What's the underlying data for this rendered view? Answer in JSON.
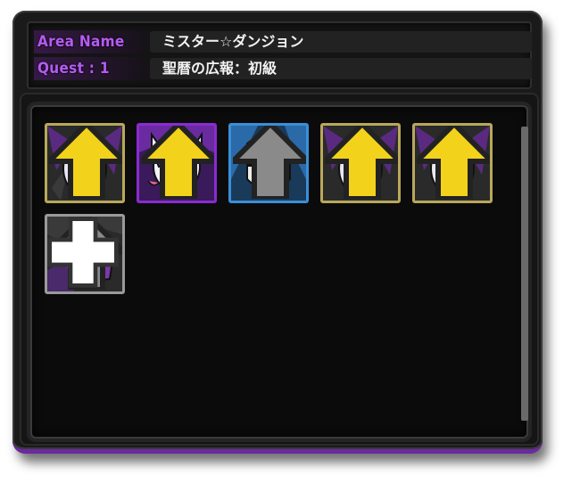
{
  "header": {
    "area_label": "Area Name",
    "area_value": "ミスター☆ダンジョン",
    "quest_label": "Quest : 1",
    "quest_value": "聖暦の広報：初級"
  },
  "party": {
    "slots": [
      {
        "icon": "white-star-mask-icon",
        "frame": "gold",
        "frame_color": "#b9a85a",
        "rank_icon": "yellow-arrow-icon"
      },
      {
        "icon": "purple-dog-mask-icon",
        "frame": "purple",
        "frame_color": "#8a2bd0",
        "rank_icon": "yellow-arrow-icon"
      },
      {
        "icon": "blue-c-mask-icon",
        "frame": "blue",
        "frame_color": "#3a8fd8",
        "rank_icon": "grey-arrow-icon"
      },
      {
        "icon": "white-star-mask-icon",
        "frame": "gold",
        "frame_color": "#b9a85a",
        "rank_icon": "yellow-arrow-icon"
      },
      {
        "icon": "white-star-mask-icon",
        "frame": "gold",
        "frame_color": "#b9a85a",
        "rank_icon": "yellow-arrow-icon"
      },
      {
        "icon": "purple-masked-fighter-icon",
        "frame": "silver",
        "frame_color": "#9a9a9a",
        "rank_icon": "grey-arrow-icon",
        "plus_icon": "plus-icon"
      }
    ]
  },
  "colors": {
    "accent_purple": "#b45cf0",
    "panel_bg": "#1a1a1a",
    "content_bg": "#0b0b0b"
  }
}
